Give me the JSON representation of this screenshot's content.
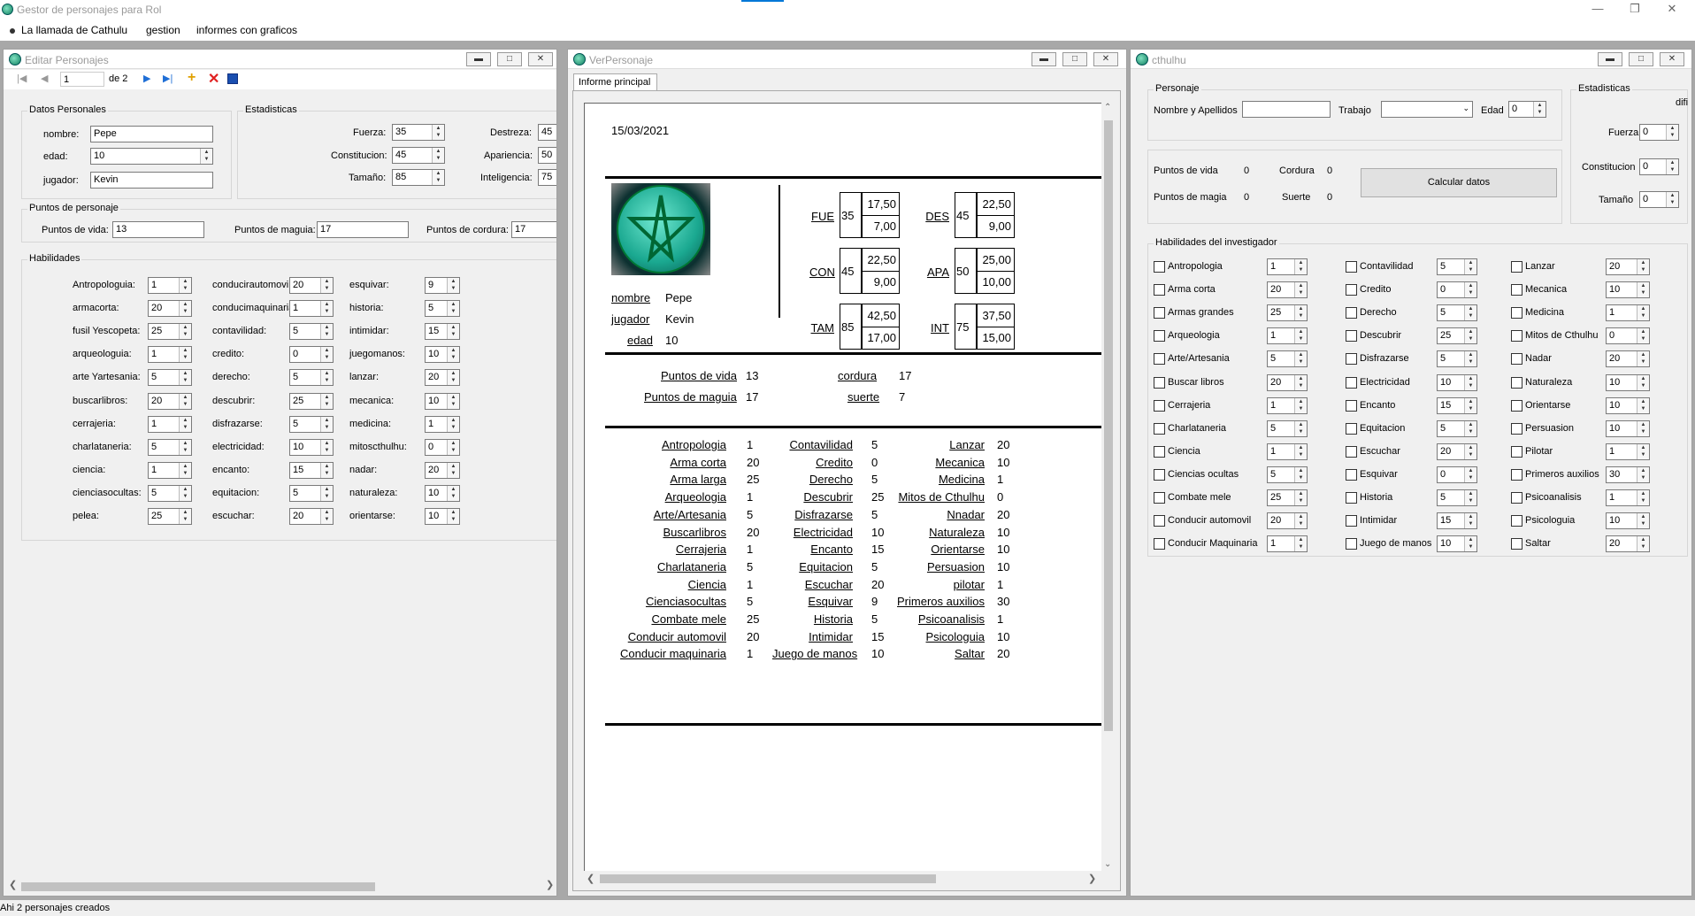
{
  "app": {
    "title": "Gestor de personajes para Rol",
    "status": "Ahi 2 personajes creados"
  },
  "menu": [
    "La llamada de Cathulu",
    "gestion",
    "informes con graficos"
  ],
  "editar": {
    "title": "Editar Personajes",
    "nav": {
      "pos": "1",
      "of": "de 2"
    },
    "datos": {
      "title": "Datos Personales",
      "nombre_l": "nombre:",
      "nombre": "Pepe",
      "edad_l": "edad:",
      "edad": "10",
      "jugador_l": "jugador:",
      "jugador": "Kevin"
    },
    "est": {
      "title": "Estadisticas",
      "fuerza_l": "Fuerza:",
      "fuerza": "35",
      "const_l": "Constitucion:",
      "const": "45",
      "tam_l": "Tamaño:",
      "tam": "85",
      "des_l": "Destreza:",
      "des": "45",
      "apa_l": "Apariencia:",
      "apa": "50",
      "int_l": "Inteligencia:",
      "int": "75"
    },
    "puntos": {
      "title": "Puntos de personaje",
      "vida_l": "Puntos de vida:",
      "vida": "13",
      "magia_l": "Puntos de maguia:",
      "magia": "17",
      "cordura_l": "Puntos de cordura:",
      "cordura": "17"
    },
    "hab_title": "Habilidades",
    "hab": [
      [
        [
          "Antropologuia:",
          "1"
        ],
        [
          "armacorta:",
          "20"
        ],
        [
          "fusil Yescopeta:",
          "25"
        ],
        [
          "arqueologuia:",
          "1"
        ],
        [
          "arte Yartesania:",
          "5"
        ],
        [
          "buscarlibros:",
          "20"
        ],
        [
          "cerrajeria:",
          "1"
        ],
        [
          "charlataneria:",
          "5"
        ],
        [
          "ciencia:",
          "1"
        ],
        [
          "cienciasocultas:",
          "5"
        ],
        [
          "pelea:",
          "25"
        ]
      ],
      [
        [
          "conducirautomovil:",
          "20"
        ],
        [
          "conducimaquinaria:",
          "1"
        ],
        [
          "contavilidad:",
          "5"
        ],
        [
          "credito:",
          "0"
        ],
        [
          "derecho:",
          "5"
        ],
        [
          "descubrir:",
          "25"
        ],
        [
          "disfrazarse:",
          "5"
        ],
        [
          "electricidad:",
          "10"
        ],
        [
          "encanto:",
          "15"
        ],
        [
          "equitacion:",
          "5"
        ],
        [
          "escuchar:",
          "20"
        ]
      ],
      [
        [
          "esquivar:",
          "9"
        ],
        [
          "historia:",
          "5"
        ],
        [
          "intimidar:",
          "15"
        ],
        [
          "juegomanos:",
          "10"
        ],
        [
          "lanzar:",
          "20"
        ],
        [
          "mecanica:",
          "10"
        ],
        [
          "medicina:",
          "1"
        ],
        [
          "mitoscthulhu:",
          "0"
        ],
        [
          "nadar:",
          "20"
        ],
        [
          "naturaleza:",
          "10"
        ],
        [
          "orientarse:",
          "10"
        ]
      ]
    ]
  },
  "ver": {
    "title": "VerPersonaje",
    "tab": "Informe principal",
    "date": "15/03/2021",
    "nombre_l": "nombre",
    "nombre": "Pepe",
    "jugador_l": "jugador",
    "jugador": "Kevin",
    "edad_l": "edad",
    "edad": "10",
    "stats": [
      {
        "n": "FUE",
        "v": "35",
        "a": "17,50",
        "b": "7,00"
      },
      {
        "n": "DES",
        "v": "45",
        "a": "22,50",
        "b": "9,00"
      },
      {
        "n": "CON",
        "v": "45",
        "a": "22,50",
        "b": "9,00"
      },
      {
        "n": "APA",
        "v": "50",
        "a": "25,00",
        "b": "10,00"
      },
      {
        "n": "TAM",
        "v": "85",
        "a": "42,50",
        "b": "17,00"
      },
      {
        "n": "INT",
        "v": "75",
        "a": "37,50",
        "b": "15,00"
      }
    ],
    "pv_l": "Puntos de vida",
    "pv": "13",
    "pm_l": "Puntos de maguia",
    "pm": "17",
    "cor_l": "cordura",
    "cor": "17",
    "sue_l": "suerte",
    "sue": "7",
    "skills": [
      [
        [
          "Antropologia",
          "1"
        ],
        [
          "Arma corta",
          "20"
        ],
        [
          "Arma larga",
          "25"
        ],
        [
          "Arqueologia",
          "1"
        ],
        [
          "Arte/Artesania",
          "5"
        ],
        [
          "Buscarlibros",
          "20"
        ],
        [
          "Cerrajeria",
          "1"
        ],
        [
          "Charlataneria",
          "5"
        ],
        [
          "Ciencia",
          "1"
        ],
        [
          "Cienciasocultas",
          "5"
        ],
        [
          "Combate mele",
          "25"
        ],
        [
          "Conducir automovil",
          "20"
        ],
        [
          "Conducir maquinaria",
          "1"
        ]
      ],
      [
        [
          "Contavilidad",
          "5"
        ],
        [
          "Credito",
          "0"
        ],
        [
          "Derecho",
          "5"
        ],
        [
          "Descubrir",
          "25"
        ],
        [
          "Disfrazarse",
          "5"
        ],
        [
          "Electricidad",
          "10"
        ],
        [
          "Encanto",
          "15"
        ],
        [
          "Equitacion",
          "5"
        ],
        [
          "Escuchar",
          "20"
        ],
        [
          "Esquivar",
          "9"
        ],
        [
          "Historia",
          "5"
        ],
        [
          "Intimidar",
          "15"
        ],
        [
          "Juego de manos",
          "10"
        ]
      ],
      [
        [
          "Lanzar",
          "20"
        ],
        [
          "Mecanica",
          "10"
        ],
        [
          "Medicina",
          "1"
        ],
        [
          "Mitos de Cthulhu",
          "0"
        ],
        [
          "Nnadar",
          "20"
        ],
        [
          "Naturaleza",
          "10"
        ],
        [
          "Orientarse",
          "10"
        ],
        [
          "Persuasion",
          "10"
        ],
        [
          "pilotar",
          "1"
        ],
        [
          "Primeros auxilios",
          "30"
        ],
        [
          "Psicoanalisis",
          "1"
        ],
        [
          "Psicologuia",
          "10"
        ],
        [
          "Saltar",
          "20"
        ]
      ]
    ]
  },
  "cth": {
    "title": "cthulhu",
    "personaje": "Personaje",
    "nombre_l": "Nombre y Apellidos",
    "trabajo_l": "Trabajo",
    "edad_l": "Edad",
    "edad": "0",
    "pv_l": "Puntos de vida",
    "pv": "0",
    "cor_l": "Cordura",
    "cor": "0",
    "pm_l": "Puntos de magia",
    "pm": "0",
    "sue_l": "Suerte",
    "sue": "0",
    "calc": "Calcular datos",
    "est_title": "Estadisticas",
    "dif": "difi",
    "fuerza_l": "Fuerza",
    "fuerza": "0",
    "const_l": "Constitucion",
    "const": "0",
    "tam_l": "Tamaño",
    "tam": "0",
    "hab_title": "Habilidades del investigador",
    "hab": [
      [
        [
          "Antropologia",
          "1"
        ],
        [
          "Arma corta",
          "20"
        ],
        [
          "Armas grandes",
          "25"
        ],
        [
          "Arqueologia",
          "1"
        ],
        [
          "Arte/Artesania",
          "5"
        ],
        [
          "Buscar libros",
          "20"
        ],
        [
          "Cerrajeria",
          "1"
        ],
        [
          "Charlataneria",
          "5"
        ],
        [
          "Ciencia",
          "1"
        ],
        [
          "Ciencias ocultas",
          "5"
        ],
        [
          "Combate mele",
          "25"
        ],
        [
          "Conducir automovil",
          "20"
        ],
        [
          "Conducir Maquinaria",
          "1"
        ]
      ],
      [
        [
          "Contavilidad",
          "5"
        ],
        [
          "Credito",
          "0"
        ],
        [
          "Derecho",
          "5"
        ],
        [
          "Descubrir",
          "25"
        ],
        [
          "Disfrazarse",
          "5"
        ],
        [
          "Electricidad",
          "10"
        ],
        [
          "Encanto",
          "15"
        ],
        [
          "Equitacion",
          "5"
        ],
        [
          "Escuchar",
          "20"
        ],
        [
          "Esquivar",
          "0"
        ],
        [
          "Historia",
          "5"
        ],
        [
          "Intimidar",
          "15"
        ],
        [
          "Juego de manos",
          "10"
        ]
      ],
      [
        [
          "Lanzar",
          "20"
        ],
        [
          "Mecanica",
          "10"
        ],
        [
          "Medicina",
          "1"
        ],
        [
          "Mitos de Cthulhu",
          "0"
        ],
        [
          "Nadar",
          "20"
        ],
        [
          "Naturaleza",
          "10"
        ],
        [
          "Orientarse",
          "10"
        ],
        [
          "Persuasion",
          "10"
        ],
        [
          "Pilotar",
          "1"
        ],
        [
          "Primeros auxilios",
          "30"
        ],
        [
          "Psicoanalisis",
          "1"
        ],
        [
          "Psicologuia",
          "10"
        ],
        [
          "Saltar",
          "20"
        ]
      ]
    ]
  },
  "colors": {
    "accent": "#0078d7",
    "cthulhu": "#20b090",
    "mdi_bg": "#a8a8a8"
  }
}
